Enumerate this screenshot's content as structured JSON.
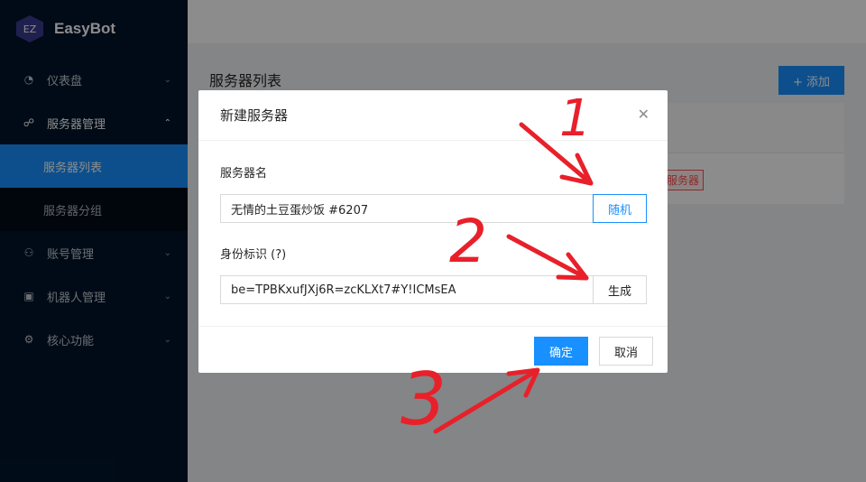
{
  "app": {
    "logo_badge": "EZ",
    "name": "EasyBot"
  },
  "sidebar": {
    "items": [
      {
        "label": "仪表盘",
        "icon": "dashboard-icon"
      },
      {
        "label": "服务器管理",
        "icon": "cluster-icon",
        "open": true,
        "children": [
          {
            "label": "服务器列表",
            "active": true
          },
          {
            "label": "服务器分组"
          }
        ]
      },
      {
        "label": "账号管理",
        "icon": "user-group-icon"
      },
      {
        "label": "机器人管理",
        "icon": "robot-icon"
      },
      {
        "label": "核心功能",
        "icon": "function-icon"
      }
    ]
  },
  "page": {
    "title": "服务器列表",
    "add_button": "+ 添加",
    "tag_text": "服务器"
  },
  "modal": {
    "title": "新建服务器",
    "server_name_label": "服务器名",
    "server_name_value": "无情的土豆蛋炒饭 #6207",
    "random_button": "随机",
    "identity_label": "身份标识 (?)",
    "identity_value": "be=TPBKxufJXj6R=zcKLXt7#Y!ICMsEA",
    "generate_button": "生成",
    "ok_button": "确定",
    "cancel_button": "取消"
  },
  "annotations": [
    "1",
    "2",
    "3"
  ],
  "colors": {
    "primary": "#1890ff",
    "sidebar_bg": "#00152a",
    "annotation": "#e8202a"
  }
}
